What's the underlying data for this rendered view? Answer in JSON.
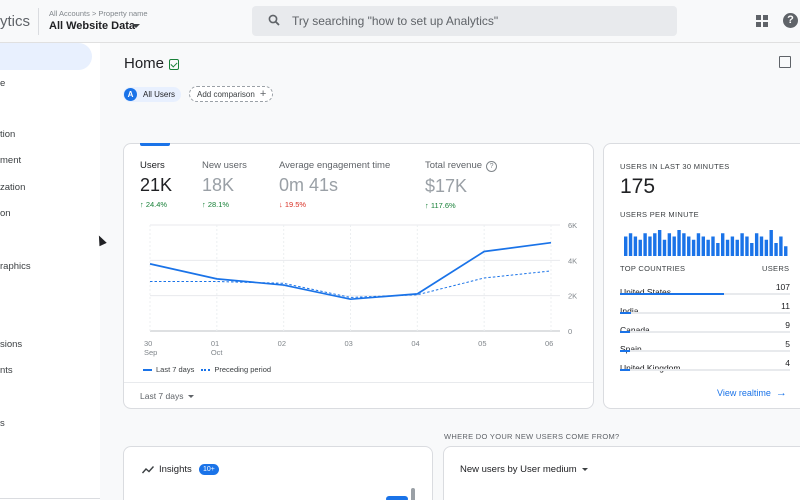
{
  "header": {
    "brand": "ytics",
    "breadcrumb": "All Accounts > Property name",
    "property": "All Website Data",
    "search_placeholder": "Try searching \"how to set up Analytics\""
  },
  "sidebar": {
    "items": [
      {
        "label": "e"
      },
      {
        "label": "tion"
      },
      {
        "label": "ment"
      },
      {
        "label": "zation"
      },
      {
        "label": "on"
      },
      {
        "label": "raphics"
      },
      {
        "label": "sions"
      },
      {
        "label": "nts"
      },
      {
        "label": "s"
      }
    ]
  },
  "page": {
    "title": "Home",
    "segment_avatar": "A",
    "segment_label": "All Users",
    "add_comparison": "Add comparison"
  },
  "metrics": [
    {
      "label": "Users",
      "value": "21K",
      "delta": "↑ 24.4%",
      "direction": "up"
    },
    {
      "label": "New users",
      "value": "18K",
      "delta": "↑ 28.1%",
      "direction": "up"
    },
    {
      "label": "Average engagement time",
      "value": "0m 41s",
      "delta": "↓ 19.5%",
      "direction": "down"
    },
    {
      "label": "Total revenue",
      "value": "$17K",
      "delta": "↑ 117.6%",
      "direction": "up"
    }
  ],
  "chart_data": {
    "type": "line",
    "x": [
      "30 Sep",
      "01 Oct",
      "02",
      "03",
      "04",
      "05",
      "06"
    ],
    "x_tick_labels": [
      [
        "30",
        "Sep"
      ],
      [
        "01",
        "Oct"
      ],
      [
        "02",
        ""
      ],
      [
        "03",
        ""
      ],
      [
        "04",
        ""
      ],
      [
        "05",
        ""
      ],
      [
        "06",
        ""
      ]
    ],
    "y_ticks": [
      "6K",
      "4K",
      "2K",
      "0"
    ],
    "ylim": [
      0,
      6000
    ],
    "series": [
      {
        "name": "Last 7 days",
        "style": "solid",
        "values": [
          3800,
          2950,
          2600,
          1800,
          2100,
          4500,
          5000
        ]
      },
      {
        "name": "Preceding period",
        "style": "dashed",
        "values": [
          2800,
          2800,
          2700,
          1900,
          2050,
          3000,
          3400
        ]
      }
    ],
    "color": "#1a73e8"
  },
  "date_range": "Last 7 days",
  "realtime": {
    "title": "USERS IN LAST 30 MINUTES",
    "value": "175",
    "per_minute_label": "USERS PER MINUTE",
    "per_minute_values": [
      6,
      7,
      6,
      5,
      7,
      6,
      7,
      8,
      5,
      7,
      6,
      8,
      7,
      6,
      5,
      7,
      6,
      5,
      6,
      4,
      7,
      5,
      6,
      5,
      7,
      6,
      4,
      7,
      6,
      5,
      8,
      4,
      6,
      3
    ],
    "countries_header": "TOP COUNTRIES",
    "users_header": "USERS",
    "countries": [
      {
        "name": "United States",
        "users": "107",
        "value": 107
      },
      {
        "name": "India",
        "users": "11",
        "value": 11
      },
      {
        "name": "Canada",
        "users": "9",
        "value": 9
      },
      {
        "name": "Spain",
        "users": "5",
        "value": 5
      },
      {
        "name": "United Kingdom",
        "users": "4",
        "value": 4
      }
    ],
    "link": "View realtime"
  },
  "bottom": {
    "caption": "WHERE DO YOUR NEW USERS COME FROM?",
    "insights_title": "Insights",
    "insights_badge": "10+",
    "medium_dropdown": "New users by User medium"
  },
  "colors": {
    "accent": "#1a73e8",
    "up": "#188038",
    "down": "#d93025"
  }
}
